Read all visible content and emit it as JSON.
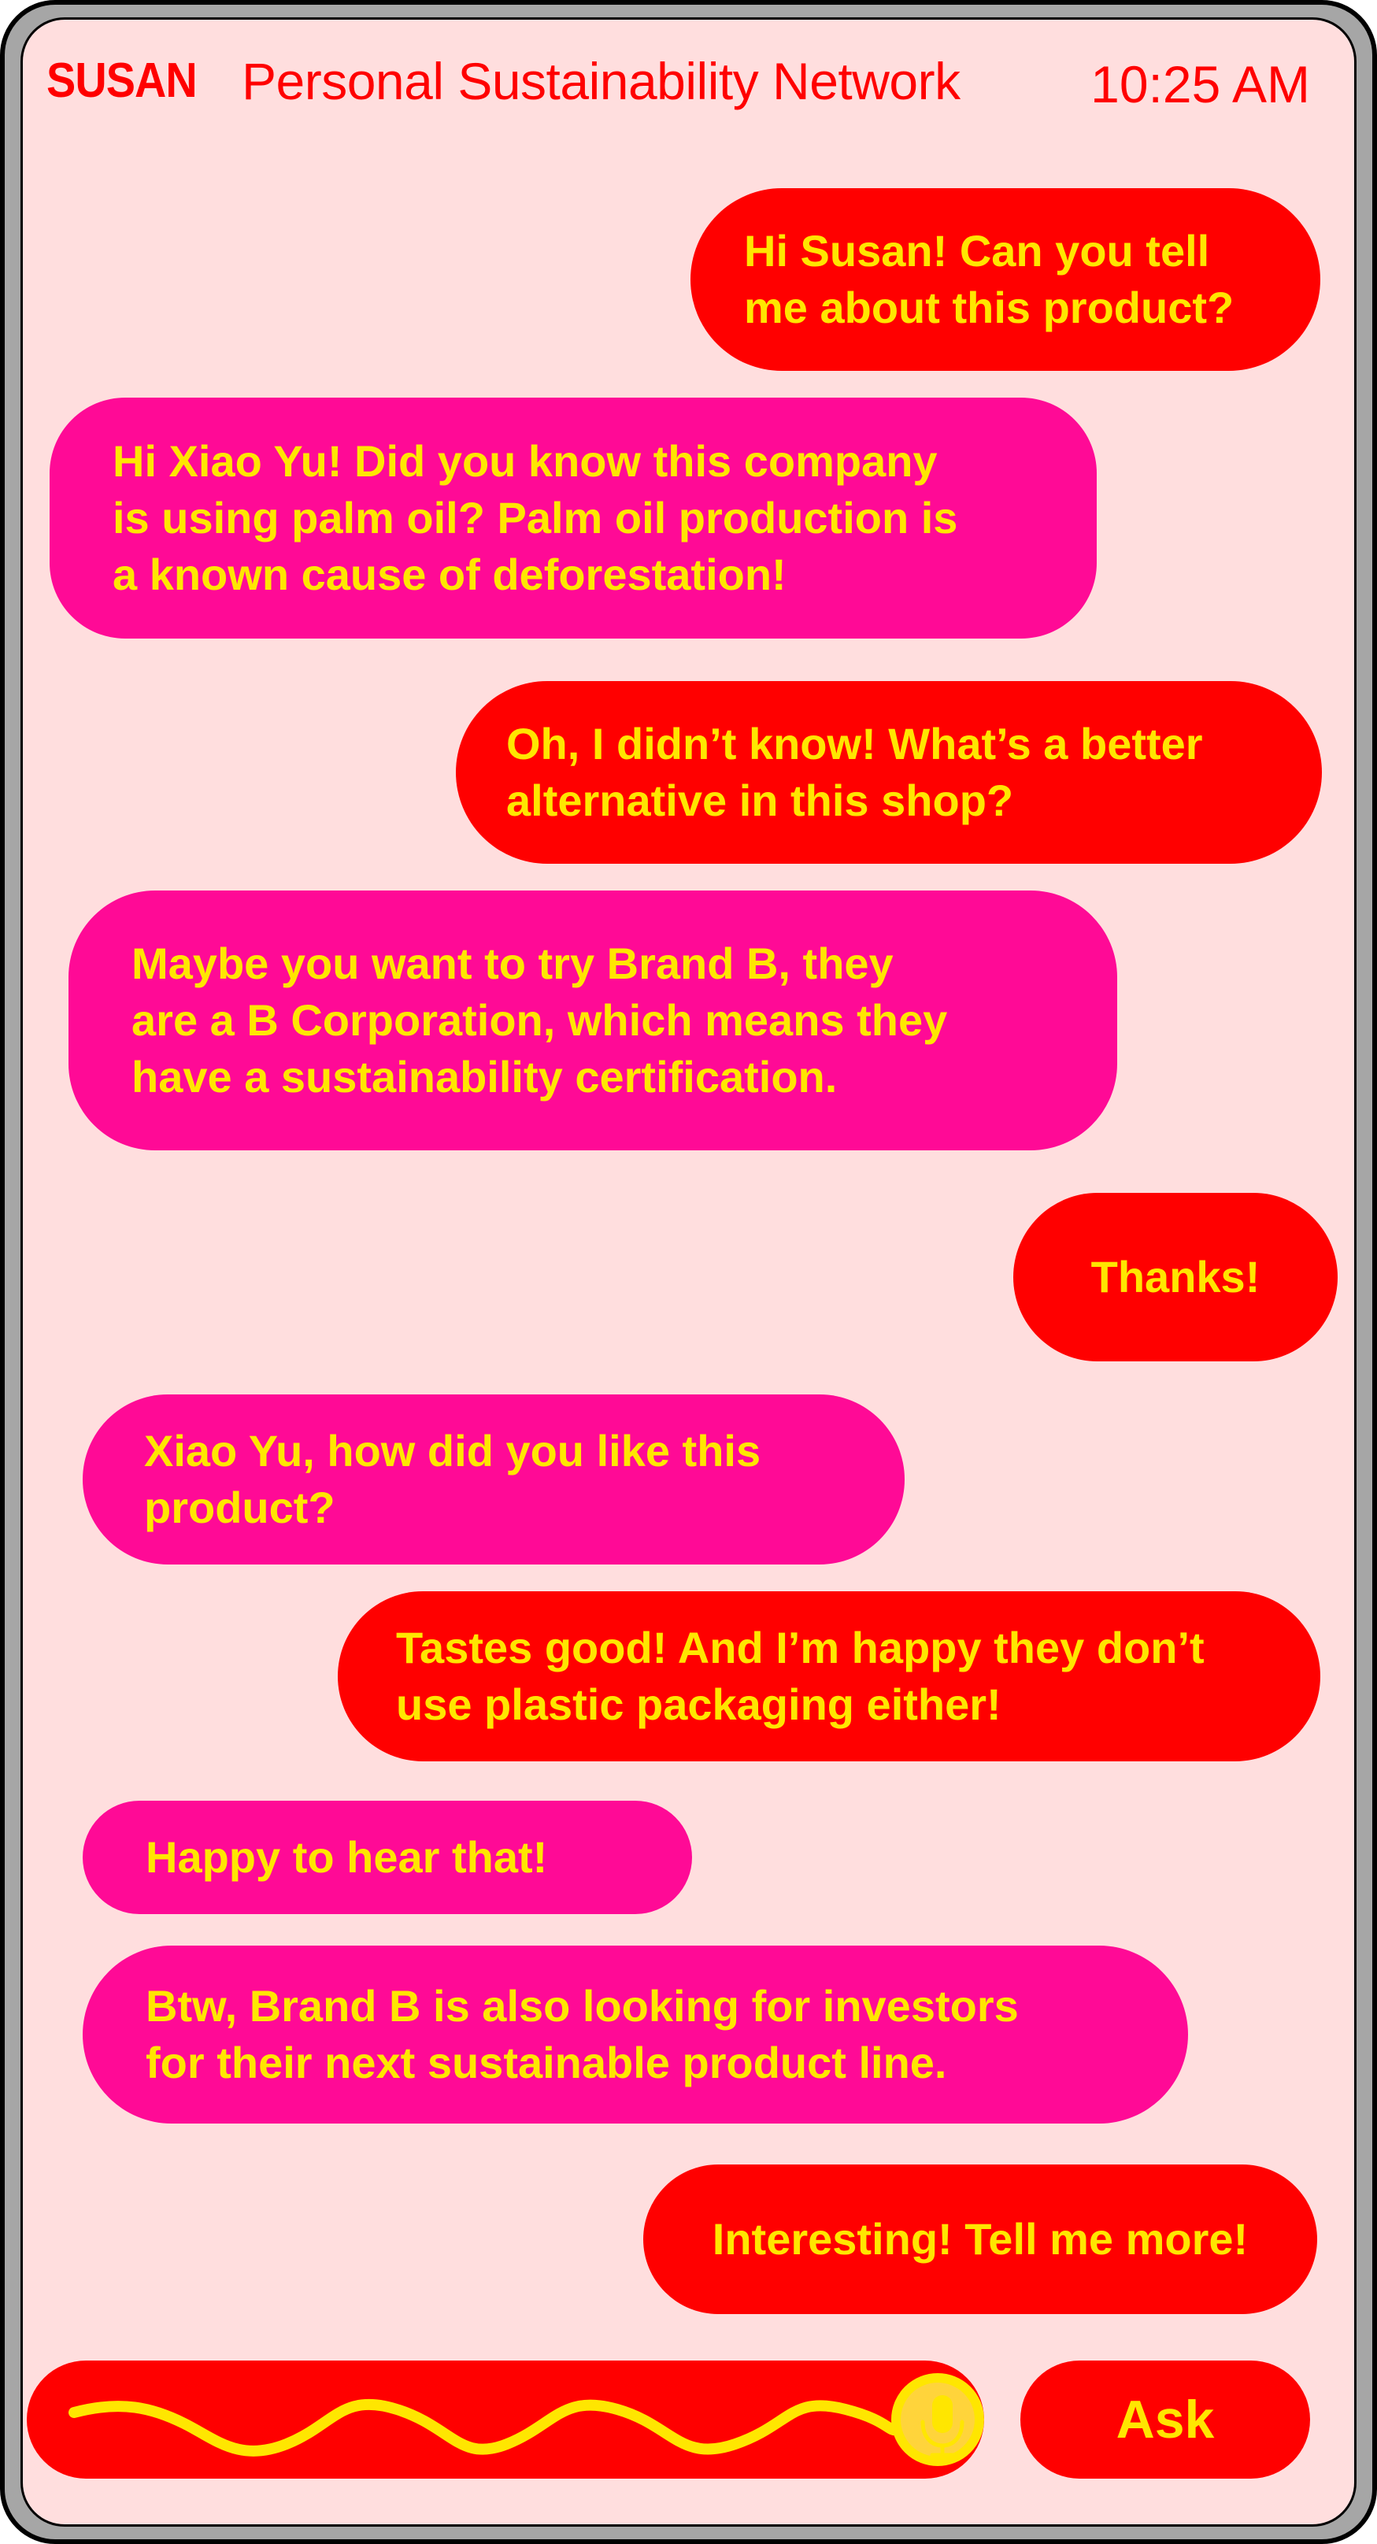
{
  "header": {
    "brand": "SUSAN",
    "title": "Personal Sustainability Network",
    "time": "10:25 AM"
  },
  "messages": [
    {
      "sender": "user",
      "lines": [
        "Hi Susan! Can you tell",
        "me about this product?"
      ]
    },
    {
      "sender": "assistant",
      "lines": [
        "Hi Xiao Yu! Did you know this company",
        "is using palm oil? Palm oil production is",
        "a known cause of deforestation!"
      ]
    },
    {
      "sender": "user",
      "lines": [
        "Oh, I didn’t know! What’s a better",
        "alternative in this shop?"
      ]
    },
    {
      "sender": "assistant",
      "lines": [
        "Maybe you want to try Brand B, they",
        "are a B Corporation, which means they",
        "have a sustainability certification."
      ]
    },
    {
      "sender": "user",
      "lines": [
        "Thanks!"
      ]
    },
    {
      "sender": "assistant",
      "lines": [
        "Xiao Yu, how did you like this",
        "product?"
      ]
    },
    {
      "sender": "user",
      "lines": [
        "Tastes good! And I’m happy they don’t",
        "use plastic packaging either!"
      ]
    },
    {
      "sender": "assistant",
      "lines": [
        "Happy to hear that!"
      ]
    },
    {
      "sender": "assistant",
      "lines": [
        "Btw, Brand B is also looking for investors",
        "for their next sustainable product line."
      ]
    },
    {
      "sender": "user",
      "lines": [
        "Interesting! Tell me more!"
      ]
    }
  ],
  "input": {
    "mic_icon": "microphone-icon",
    "wave_icon": "voice-waveform",
    "ask_label": "Ask"
  },
  "colors": {
    "background": "#ffdede",
    "user_bubble": "#ff0000",
    "assistant_bubble": "#ff0a96",
    "text": "#ffe600",
    "frame": "#a6a6a6"
  }
}
